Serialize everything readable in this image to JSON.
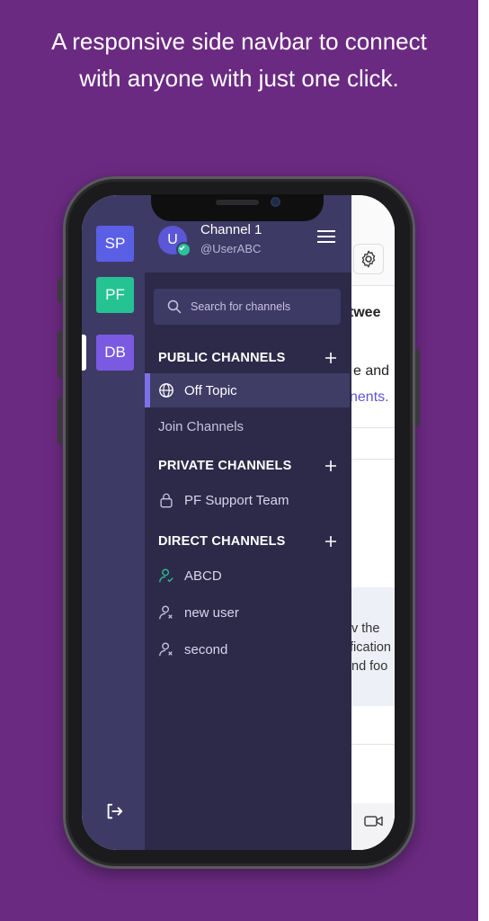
{
  "caption": {
    "line1": "A responsive side navbar to connect",
    "line2": "with anyone with just one click."
  },
  "workspaces": [
    {
      "label": "SP",
      "color": "#5b5fe6"
    },
    {
      "label": "PF",
      "color": "#24c391"
    },
    {
      "label": "DB",
      "color": "#7a5ae0"
    }
  ],
  "header": {
    "avatar_initial": "U",
    "channel_name": "Channel 1",
    "username": "@UserABC"
  },
  "search": {
    "placeholder": "Search for channels"
  },
  "public": {
    "title": "PUBLIC CHANNELS",
    "items": [
      {
        "label": "Off Topic"
      }
    ],
    "join_label": "Join Channels"
  },
  "private": {
    "title": "PRIVATE CHANNELS",
    "items": [
      {
        "label": "PF Support Team"
      }
    ]
  },
  "direct": {
    "title": "DIRECT CHANNELS",
    "items": [
      {
        "label": "ABCD",
        "status": "online"
      },
      {
        "label": "new user",
        "status": "offline"
      },
      {
        "label": "second",
        "status": "offline"
      }
    ]
  },
  "content_fragments": {
    "line1": "etwee",
    "line2": "e and",
    "line3": "nents.",
    "line4": "v the",
    "line5": "fication",
    "line6": "nd foo"
  },
  "colors": {
    "background": "#6b2a82",
    "rail": "#3e3a66",
    "drawer": "#2c2a48",
    "accent": "#7c72e6",
    "online": "#2bc29a"
  }
}
